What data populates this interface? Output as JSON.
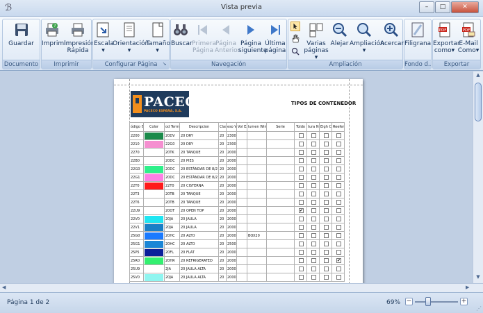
{
  "window": {
    "title": "Vista previa",
    "buttons": [
      "minimize",
      "maximize",
      "close"
    ]
  },
  "ribbon": {
    "groups": [
      {
        "label": "Documento",
        "buttons": [
          {
            "label": "Guardar",
            "icon": "save-icon"
          }
        ]
      },
      {
        "label": "Imprimir",
        "buttons": [
          {
            "label": "Imprimir",
            "icon": "printer-icon"
          },
          {
            "label": "Impresión Rápida",
            "icon": "quick-print-icon"
          }
        ]
      },
      {
        "label": "Configurar Página",
        "buttons": [
          {
            "label": "Escala",
            "icon": "scale-icon",
            "dropdown": true
          },
          {
            "label": "Orientación",
            "icon": "orientation-icon",
            "dropdown": true
          },
          {
            "label": "Tamaño",
            "icon": "size-icon",
            "dropdown": true
          }
        ]
      },
      {
        "label": "Navegación",
        "buttons": [
          {
            "label": "Buscar",
            "icon": "binoculars-icon"
          },
          {
            "label": "Primera Página",
            "icon": "first-page-icon",
            "disabled": true
          },
          {
            "label": "Página Anterior",
            "icon": "previous-page-icon",
            "disabled": true
          },
          {
            "label": "Página siguiente",
            "icon": "next-page-icon"
          },
          {
            "label": "Última página",
            "icon": "last-page-icon"
          }
        ]
      },
      {
        "label": "Ampliación",
        "buttons": [
          {
            "label": "Varias páginas",
            "icon": "multiple-pages-icon",
            "dropdown": true
          },
          {
            "label": "Alejar",
            "icon": "zoom-out-icon"
          },
          {
            "label": "Ampliación",
            "icon": "zoom-icon",
            "dropdown": true
          },
          {
            "label": "Acercar",
            "icon": "zoom-in-icon"
          }
        ]
      },
      {
        "label": "Fondo d...",
        "buttons": [
          {
            "label": "Filigrana",
            "icon": "watermark-icon"
          }
        ]
      },
      {
        "label": "Exportar",
        "buttons": [
          {
            "label": "Exportar como",
            "icon": "export-pdf-icon",
            "dropdown": true
          },
          {
            "label": "E-Mail Como",
            "icon": "email-pdf-icon",
            "dropdown": true
          }
        ]
      }
    ]
  },
  "report": {
    "company": "PACECO",
    "company_sub": "PACECO ESPAÑA, S.A.",
    "title": "TIPOS DE CONTENEDOR",
    "headers": [
      "ódigo IS",
      "Color",
      "od Termir",
      "Descripcion",
      "Clase",
      "eso Vac",
      "Vol Ext",
      "lumen Win",
      "Serie",
      "Toldo",
      "tura No",
      "Eigh Cub",
      "Reefer"
    ],
    "rows": [
      {
        "code": "2200",
        "color": "#1a8a4a",
        "term": "20DV",
        "desc": "20 DRY",
        "clase": "20",
        "peso": "2300",
        "volext": "",
        "volint": "",
        "serie": "",
        "checks": [
          false,
          false,
          false,
          false
        ]
      },
      {
        "code": "2210",
        "color": "#f58fd0",
        "term": "22G0",
        "desc": "20 DRY",
        "clase": "20",
        "peso": "2300",
        "volext": "",
        "volint": "",
        "serie": "",
        "checks": [
          false,
          false,
          false,
          false
        ]
      },
      {
        "code": "2270",
        "color": "",
        "term": "20TK",
        "desc": "20 TANQUE",
        "clase": "20",
        "peso": "2000",
        "volext": "",
        "volint": "",
        "serie": "",
        "checks": [
          false,
          false,
          false,
          false
        ]
      },
      {
        "code": "22B0",
        "color": "",
        "term": "20DC",
        "desc": "20 PIES",
        "clase": "20",
        "peso": "2000",
        "volext": "",
        "volint": "",
        "serie": "",
        "checks": [
          false,
          false,
          false,
          false
        ]
      },
      {
        "code": "22G0",
        "color": "#2ef08a",
        "term": "20DC",
        "desc": "20 ESTÁNDAR DE 8/2",
        "clase": "20",
        "peso": "2000",
        "volext": "",
        "volint": "",
        "serie": "",
        "checks": [
          false,
          false,
          false,
          false
        ]
      },
      {
        "code": "22G1",
        "color": "#ff7fe6",
        "term": "20DC",
        "desc": "20 ESTÁNDAR DE 8/2",
        "clase": "20",
        "peso": "2000",
        "volext": "",
        "volint": "",
        "serie": "",
        "checks": [
          false,
          false,
          false,
          false
        ]
      },
      {
        "code": "22T0",
        "color": "#ff1a1a",
        "term": "22T0",
        "desc": "20 CISTERNA",
        "clase": "20",
        "peso": "2000",
        "volext": "",
        "volint": "",
        "serie": "",
        "checks": [
          false,
          false,
          false,
          false
        ]
      },
      {
        "code": "22T3",
        "color": "",
        "term": "20TB",
        "desc": "20 TANQUE",
        "clase": "20",
        "peso": "2000",
        "volext": "",
        "volint": "",
        "serie": "",
        "checks": [
          false,
          false,
          false,
          false
        ]
      },
      {
        "code": "22T6",
        "color": "",
        "term": "20TB",
        "desc": "20 TANQUE",
        "clase": "20",
        "peso": "2000",
        "volext": "",
        "volint": "",
        "serie": "",
        "checks": [
          false,
          false,
          false,
          false
        ]
      },
      {
        "code": "22U9",
        "color": "",
        "term": "20OT",
        "desc": "20 OPEN TOP",
        "clase": "20",
        "peso": "2000",
        "volext": "",
        "volint": "",
        "serie": "",
        "checks": [
          true,
          false,
          false,
          false
        ]
      },
      {
        "code": "22V0",
        "color": "#1fe6f2",
        "term": "20JA",
        "desc": "20 JAULA",
        "clase": "20",
        "peso": "2000",
        "volext": "",
        "volint": "",
        "serie": "",
        "checks": [
          false,
          false,
          false,
          false
        ]
      },
      {
        "code": "22V1",
        "color": "#1a7fc6",
        "term": "20JA",
        "desc": "20 JAULA",
        "clase": "20",
        "peso": "2000",
        "volext": "",
        "volint": "",
        "serie": "",
        "checks": [
          false,
          false,
          false,
          false
        ]
      },
      {
        "code": "25G0",
        "color": "#1a7aff",
        "term": "20HC",
        "desc": "20 ALTO",
        "clase": "20",
        "peso": "2000",
        "volext": "",
        "volint": "BOX20",
        "serie": "",
        "checks": [
          false,
          false,
          false,
          false
        ]
      },
      {
        "code": "25G1",
        "color": "#1a86d6",
        "term": "20HC",
        "desc": "20 ALTO",
        "clase": "20",
        "peso": "2500",
        "volext": "",
        "volint": "",
        "serie": "",
        "checks": [
          false,
          false,
          false,
          false
        ]
      },
      {
        "code": "25P5",
        "color": "#0a1f9a",
        "term": "20FL",
        "desc": "20 FLAT",
        "clase": "20",
        "peso": "2000",
        "volext": "",
        "volint": "",
        "serie": "",
        "checks": [
          false,
          false,
          false,
          false
        ]
      },
      {
        "code": "25R0",
        "color": "#33f070",
        "term": "20HR",
        "desc": "20 REFRIGERATED",
        "clase": "20",
        "peso": "2000",
        "volext": "",
        "volint": "",
        "serie": "",
        "checks": [
          false,
          false,
          false,
          true
        ]
      },
      {
        "code": "25U9",
        "color": "",
        "term": "2JA",
        "desc": "20 JAULA ALTA",
        "clase": "20",
        "peso": "2000",
        "volext": "",
        "volint": "",
        "serie": "",
        "checks": [
          false,
          false,
          false,
          false
        ]
      },
      {
        "code": "25V0",
        "color": "#8ff5f0",
        "term": "20JA",
        "desc": "20 JAULA ALTA",
        "clase": "20",
        "peso": "2000",
        "volext": "",
        "volint": "",
        "serie": "",
        "checks": [
          false,
          false,
          false,
          false
        ]
      }
    ]
  },
  "status": {
    "page": "Página 1 de 2",
    "zoom": "69%",
    "zoom_fraction": 0.69
  },
  "colors": {
    "ribbon_bg": "#dbe6f4",
    "accent": "#1e395b",
    "logo_bg": "#1f3b5c",
    "logo_orange": "#f28e1c"
  }
}
